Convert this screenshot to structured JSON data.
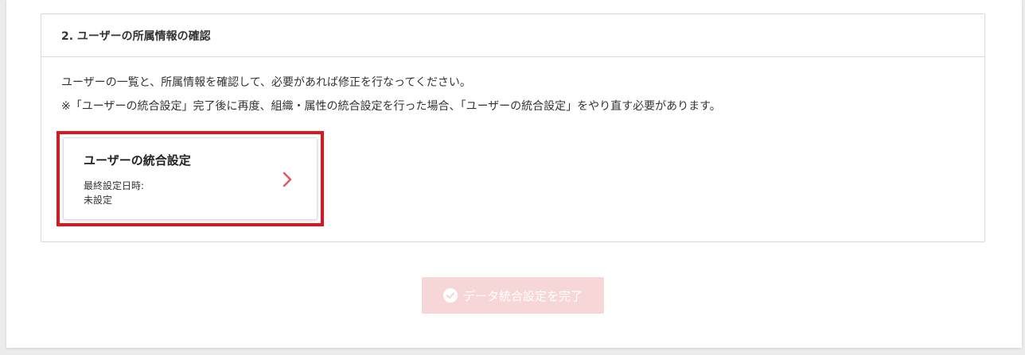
{
  "section": {
    "title": "2. ユーザーの所属情報の確認",
    "description": "ユーザーの一覧と、所属情報を確認して、必要があれば修正を行なってください。",
    "note": "※「ユーザーの統合設定」完了後に再度、組織・属性の統合設定を行った場合、「ユーザーの統合設定」をやり直す必要があります。"
  },
  "card": {
    "title": "ユーザーの統合設定",
    "last_set_label": "最終設定日時:",
    "last_set_value": "未設定",
    "icon": "chevron-right-icon"
  },
  "footer": {
    "complete_label": "データ統合設定を完了",
    "complete_icon": "check-circle-icon",
    "disabled": true
  },
  "colors": {
    "highlight": "#e0141e",
    "chevron": "#e05a60",
    "button_disabled": "#f7d6d8"
  }
}
